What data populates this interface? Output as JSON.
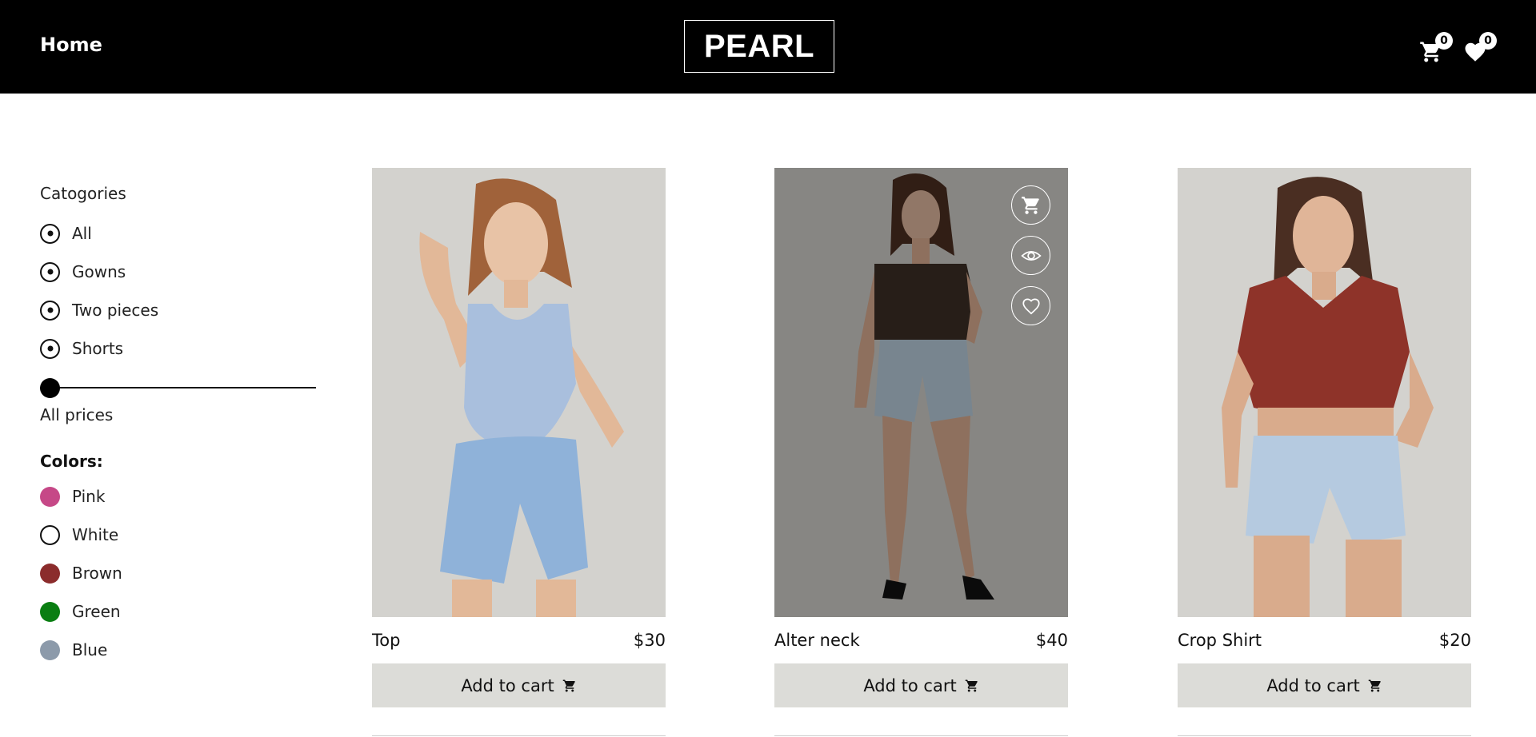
{
  "header": {
    "home_label": "Home",
    "logo_text": "PEARL",
    "cart_count": "0",
    "wishlist_count": "0"
  },
  "sidebar": {
    "categories_title": "Catogories",
    "categories": [
      {
        "label": "All"
      },
      {
        "label": "Gowns"
      },
      {
        "label": "Two pieces"
      },
      {
        "label": "Shorts"
      }
    ],
    "price_label": "All prices",
    "price_value_percent": 0,
    "colors_title": "Colors:",
    "colors": [
      {
        "label": "Pink",
        "color": "#c64887"
      },
      {
        "label": "White",
        "color": "#ffffff"
      },
      {
        "label": "Brown",
        "color": "#8b2c2c"
      },
      {
        "label": "Green",
        "color": "#0a7e12"
      },
      {
        "label": "Blue",
        "color": "#8c9aaa"
      }
    ]
  },
  "products": [
    {
      "name": "Top",
      "price": "$30",
      "button_label": "Add to cart",
      "image_icon": "model-blue-top-photo",
      "top_color": "#a9bfdd",
      "hair": "#a0623a"
    },
    {
      "name": "Alter neck",
      "price": "$40",
      "button_label": "Add to cart",
      "image_icon": "model-halter-top-photo",
      "top_color": "#3b2e25",
      "hair": "#4a2e20",
      "hovered": true
    },
    {
      "name": "Crop Shirt",
      "price": "$20",
      "button_label": "Add to cart",
      "image_icon": "model-crop-shirt-photo",
      "top_color": "#8e3329",
      "hair": "#4a2e22"
    }
  ],
  "colors": {
    "header_bg": "#000000",
    "button_bg": "#dcdcd8",
    "photo_bg": "#d3d2ce"
  }
}
